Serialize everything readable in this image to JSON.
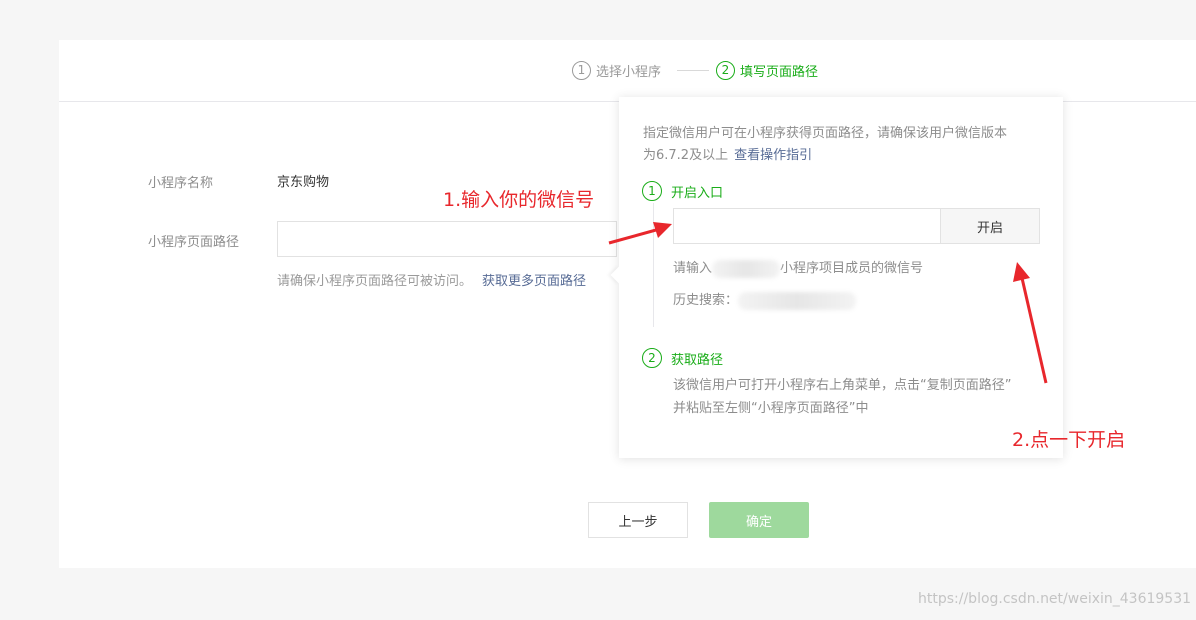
{
  "steps": [
    {
      "num": "1",
      "label": "选择小程序"
    },
    {
      "num": "2",
      "label": "填写页面路径"
    }
  ],
  "form": {
    "name_label": "小程序名称",
    "name_value": "京东购物",
    "path_label": "小程序页面路径",
    "path_value": "",
    "tip": "请确保小程序页面路径可被访问。",
    "tip_link": "获取更多页面路径"
  },
  "popover": {
    "desc_line1": "指定微信用户可在小程序获得页面路径，请确保该用户微信版本",
    "desc_line2": "为6.7.2及以上",
    "desc_link": "查看操作指引",
    "step1": {
      "num": "1",
      "label": "开启入口"
    },
    "wechat_input_value": "",
    "open_button": "开启",
    "hint_prefix": "请输入",
    "hint_suffix": "小程序项目成员的微信号",
    "history_label": "历史搜索：",
    "step2": {
      "num": "2",
      "label": "获取路径"
    },
    "note_line1": "该微信用户可打开小程序右上角菜单，点击“复制页面路径”",
    "note_line2": "并粘贴至左侧“小程序页面路径”中"
  },
  "buttons": {
    "prev": "上一步",
    "confirm": "确定"
  },
  "annotations": {
    "a1": "1.输入你的微信号",
    "a2": "2.点一下开启"
  },
  "watermark": "https://blog.csdn.net/weixin_43619531",
  "colors": {
    "accent": "#1aad19",
    "link": "#576b95",
    "annotation": "#e8272c",
    "confirm_disabled": "#9ed99d"
  }
}
